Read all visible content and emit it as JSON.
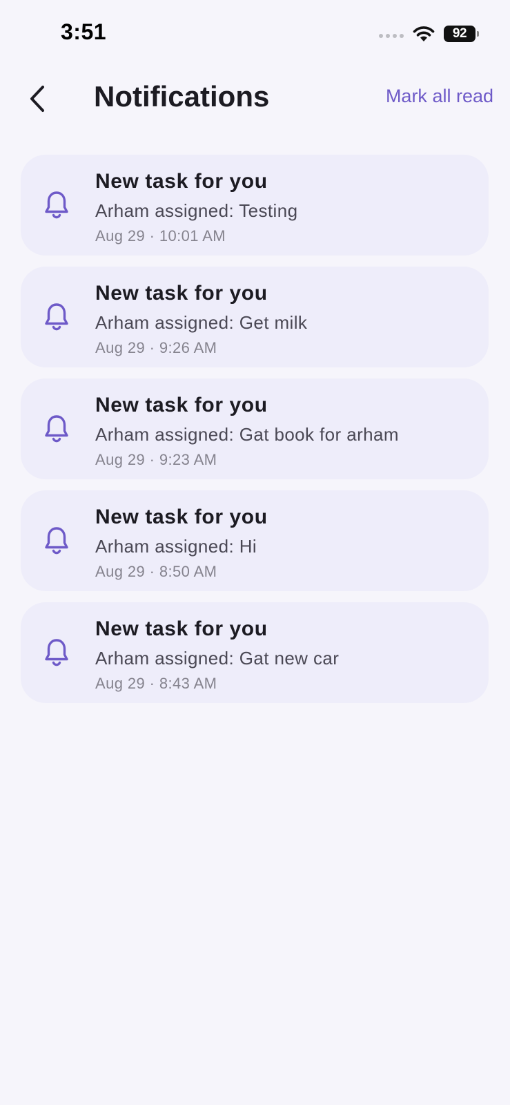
{
  "status_bar": {
    "time": "3:51",
    "battery": "92"
  },
  "header": {
    "title": "Notifications",
    "mark_all_label": "Mark all read"
  },
  "colors": {
    "accent": "#6e5ac8",
    "card_bg": "#eeedfa",
    "page_bg": "#f6f5fb"
  },
  "notifications": [
    {
      "icon": "bell-icon",
      "title": "New task for you",
      "body": "Arham assigned: Testing",
      "time": "Aug 29 · 10:01 AM"
    },
    {
      "icon": "bell-icon",
      "title": "New task for you",
      "body": "Arham assigned: Get milk",
      "time": "Aug 29 · 9:26 AM"
    },
    {
      "icon": "bell-icon",
      "title": "New task for you",
      "body": "Arham assigned: Gat book for arham",
      "time": "Aug 29 · 9:23 AM"
    },
    {
      "icon": "bell-icon",
      "title": "New task for you",
      "body": "Arham assigned: Hi",
      "time": "Aug 29 · 8:50 AM"
    },
    {
      "icon": "bell-icon",
      "title": "New task for you",
      "body": "Arham assigned: Gat new car",
      "time": "Aug 29 · 8:43 AM"
    }
  ]
}
